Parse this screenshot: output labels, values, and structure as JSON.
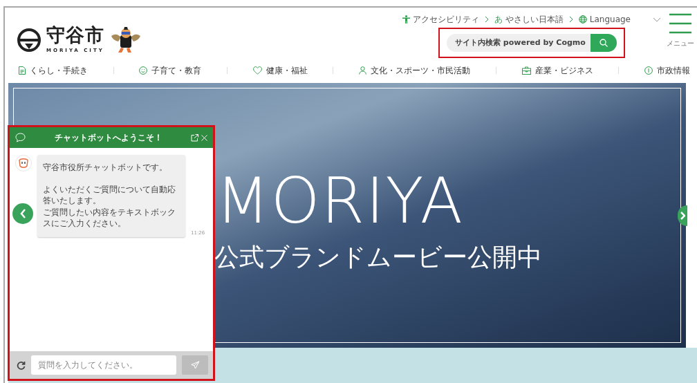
{
  "logo": {
    "name": "守谷市",
    "subtitle": "MORIYA CITY"
  },
  "utility_links": [
    {
      "kind": "accessibility",
      "label": "アクセシビリティ"
    },
    {
      "kind": "easy",
      "label": "やさしい日本語",
      "mark": "あ"
    },
    {
      "kind": "language",
      "label": "Language"
    }
  ],
  "search": {
    "placeholder": "サイト内検索 powered by Cogmo",
    "highlighted": true
  },
  "menu_button": {
    "label": "メニュー"
  },
  "nav": [
    {
      "kind": "document",
      "label": "くらし・手続き"
    },
    {
      "kind": "smile",
      "label": "子育て・教育"
    },
    {
      "kind": "heart",
      "label": "健康・福祉"
    },
    {
      "kind": "person",
      "label": "文化・スポーツ・市民活動"
    },
    {
      "kind": "briefcase",
      "label": "産業・ビジネス"
    },
    {
      "kind": "info",
      "label": "市政情報"
    }
  ],
  "hero": {
    "title": "MORIYA",
    "subtitle": "公式ブランドムービー公開中"
  },
  "chatbot": {
    "title": "チャットボットへようこそ！",
    "highlighted": true,
    "messages": [
      {
        "paragraphs": [
          [
            "守谷市役所チャットボットです。"
          ],
          [
            "よくいただくご質問について自動応答いたします。",
            "ご質問したい内容をテキストボックスにご入力ください。"
          ]
        ],
        "time": "11:26"
      }
    ],
    "input": {
      "placeholder": "質問を入力してください。"
    }
  }
}
